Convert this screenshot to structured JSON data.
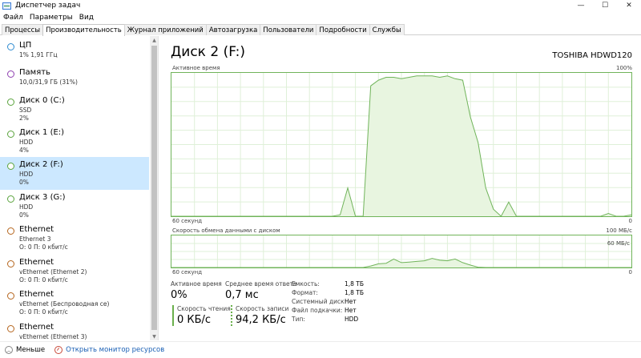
{
  "window": {
    "title": "Диспетчер задач"
  },
  "menu": [
    "Файл",
    "Параметры",
    "Вид"
  ],
  "tabs": [
    {
      "label": "Процессы",
      "active": false
    },
    {
      "label": "Производительность",
      "active": true
    },
    {
      "label": "Журнал приложений",
      "active": false
    },
    {
      "label": "Автозагрузка",
      "active": false
    },
    {
      "label": "Пользователи",
      "active": false
    },
    {
      "label": "Подробности",
      "active": false
    },
    {
      "label": "Службы",
      "active": false
    }
  ],
  "sidebar": {
    "items": [
      {
        "title": "ЦП",
        "sub1": "1% 1,91 ГГц",
        "sub2": "",
        "selected": false
      },
      {
        "title": "Память",
        "sub1": "10,0/31,9 ГБ (31%)",
        "sub2": "",
        "selected": false
      },
      {
        "title": "Диск 0 (C:)",
        "sub1": "SSD",
        "sub2": "2%",
        "selected": false
      },
      {
        "title": "Диск 1 (E:)",
        "sub1": "HDD",
        "sub2": "4%",
        "selected": false
      },
      {
        "title": "Диск 2 (F:)",
        "sub1": "HDD",
        "sub2": "0%",
        "selected": true
      },
      {
        "title": "Диск 3 (G:)",
        "sub1": "HDD",
        "sub2": "0%",
        "selected": false
      },
      {
        "title": "Ethernet",
        "sub1": "Ethernet 3",
        "sub2": "О: 0 П: 0 кбит/с",
        "selected": false
      },
      {
        "title": "Ethernet",
        "sub1": "vEthernet (Ethernet 2)",
        "sub2": "О: 0 П: 0 кбит/с",
        "selected": false
      },
      {
        "title": "Ethernet",
        "sub1": "vEthernet (Беспроводная се)",
        "sub2": "О: 0 П: 0 кбит/с",
        "selected": false
      },
      {
        "title": "Ethernet",
        "sub1": "vEthernet (Ethernet 3)",
        "sub2": "",
        "selected": false
      }
    ]
  },
  "main": {
    "title": "Диск 2 (F:)",
    "model": "TOSHIBA HDWD120",
    "graph1": {
      "label": "Активное время",
      "max_label": "100%",
      "time_label": "60 секунд",
      "min_label": "0"
    },
    "graph2": {
      "label": "Скорость обмена данными с диском",
      "max_label": "100 МБ/с",
      "inner_label": "60 МБ/с",
      "time_label": "60 секунд",
      "min_label": "0"
    }
  },
  "stats": {
    "active_time_label": "Активное время",
    "active_time_value": "0%",
    "response_label": "Среднее время ответа",
    "response_value": "0,7 мс",
    "read_label": "Скорость чтения",
    "read_value": "0 КБ/с",
    "write_label": "Скорость записи",
    "write_value": "94,2 КБ/с"
  },
  "properties": [
    {
      "label": "Емкость:",
      "value": "1,8 ТБ"
    },
    {
      "label": "Формат:",
      "value": "1,8 ТБ"
    },
    {
      "label": "Системный диск:",
      "value": "Нет"
    },
    {
      "label": "Файл подкачки:",
      "value": "Нет"
    },
    {
      "label": "Тип:",
      "value": "HDD"
    }
  ],
  "footer": {
    "less_label": "Меньше",
    "monitor_label": "Открыть монитор ресурсов"
  },
  "colors": {
    "accent": "#70b45a",
    "fill": "#e8f5e0",
    "selected": "#cce8ff",
    "circle": "#2e8bd1"
  },
  "chart_data": [
    {
      "type": "area",
      "title": "Активное время",
      "xlabel": "60 секунд",
      "ylim": [
        0,
        100
      ],
      "x": [
        0,
        1,
        2,
        3,
        4,
        5,
        6,
        7,
        8,
        9,
        10,
        11,
        12,
        13,
        14,
        15,
        16,
        17,
        18,
        19,
        20,
        21,
        22,
        23,
        24,
        25,
        26,
        27,
        28,
        29,
        30,
        31,
        32,
        33,
        34,
        35,
        36,
        37,
        38,
        39,
        40,
        41,
        42,
        43,
        44,
        45,
        46,
        47,
        48,
        49,
        50,
        51,
        52,
        53,
        54,
        55,
        56,
        57,
        58,
        59,
        60
      ],
      "values": [
        0,
        0,
        0,
        0,
        0,
        0,
        0,
        0,
        0,
        0,
        0,
        0,
        0,
        0,
        0,
        0,
        0,
        0,
        0,
        0,
        0,
        0,
        1,
        20,
        0,
        0,
        92,
        96,
        98,
        98,
        97,
        98,
        99,
        99,
        99,
        98,
        99,
        97,
        96,
        70,
        52,
        20,
        5,
        0,
        10,
        0,
        0,
        0,
        0,
        0,
        0,
        0,
        0,
        0,
        0,
        0,
        0,
        2,
        0,
        0,
        1
      ]
    },
    {
      "type": "area",
      "title": "Скорость обмена данными с диском",
      "xlabel": "60 секунд",
      "ylim": [
        0,
        100
      ],
      "x": [
        0,
        1,
        2,
        3,
        4,
        5,
        6,
        7,
        8,
        9,
        10,
        11,
        12,
        13,
        14,
        15,
        16,
        17,
        18,
        19,
        20,
        21,
        22,
        23,
        24,
        25,
        26,
        27,
        28,
        29,
        30,
        31,
        32,
        33,
        34,
        35,
        36,
        37,
        38,
        39,
        40,
        41,
        42,
        43,
        44,
        45,
        46,
        47,
        48,
        49,
        50,
        51,
        52,
        53,
        54,
        55,
        56,
        57,
        58,
        59,
        60
      ],
      "values": [
        0,
        0,
        0,
        0,
        0,
        0,
        0,
        0,
        0,
        0,
        0,
        0,
        0,
        0,
        0,
        0,
        0,
        0,
        0,
        0,
        0,
        0,
        0,
        0,
        0,
        0,
        5,
        12,
        14,
        28,
        16,
        18,
        20,
        22,
        30,
        24,
        22,
        28,
        16,
        8,
        1,
        0,
        0,
        0,
        0,
        0,
        0,
        0,
        0,
        0,
        0,
        0,
        0,
        0,
        0,
        0,
        0,
        0,
        0,
        0,
        0
      ]
    }
  ]
}
